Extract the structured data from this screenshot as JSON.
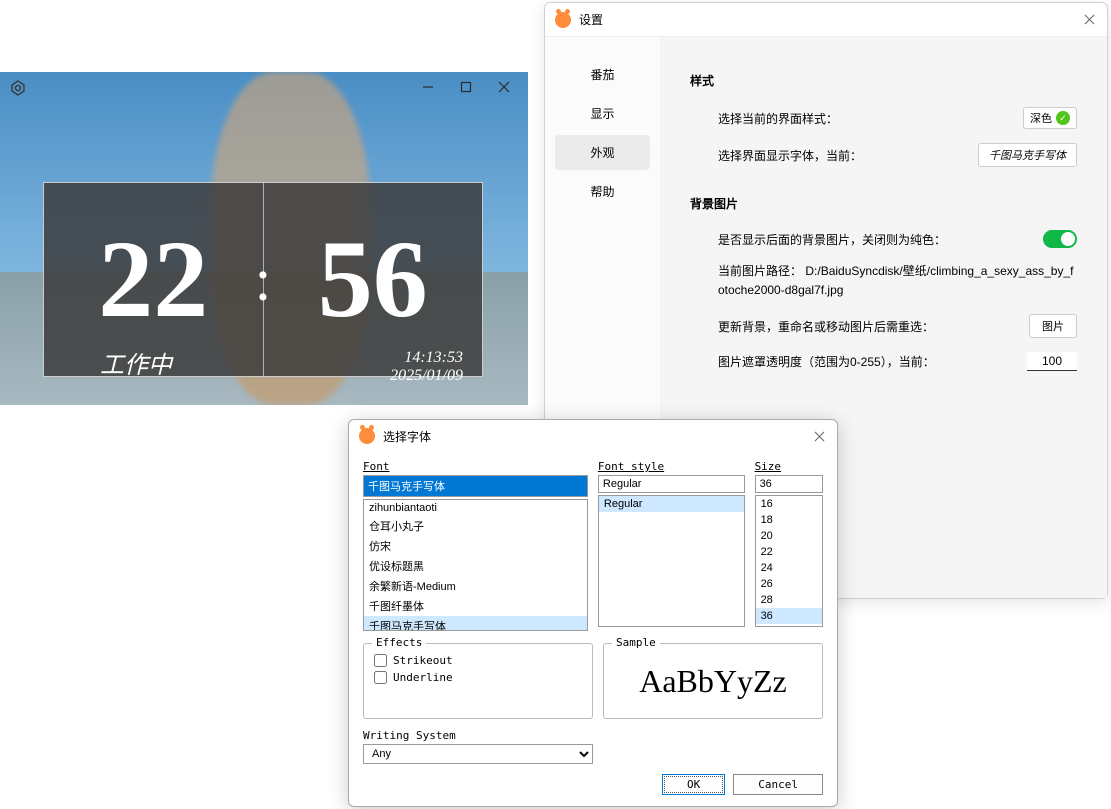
{
  "timer": {
    "hours": "22",
    "minutes": "56",
    "status": "工作中",
    "time": "14:13:53",
    "date": "2025/01/09"
  },
  "settings": {
    "title": "设置",
    "nav": [
      "番茄",
      "显示",
      "外观",
      "帮助"
    ],
    "style_section": "样式",
    "style_label": "选择当前的界面样式：",
    "style_value": "深色",
    "font_label": "选择界面显示字体，当前：",
    "font_value": "千图马克手写体",
    "bg_section": "背景图片",
    "bg_toggle_label": "是否显示后面的背景图片，关闭则为纯色：",
    "bg_path_label": "当前图片路径：",
    "bg_path": "D:/BaiduSyncdisk/壁纸/climbing_a_sexy_ass_by_fotoche2000-d8gal7f.jpg",
    "bg_update_label": "更新背景，重命名或移动图片后需重选：",
    "bg_update_btn": "图片",
    "bg_opacity_label": "图片遮罩透明度（范围为0-255），当前：",
    "bg_opacity_value": "100"
  },
  "font_dialog": {
    "title": "选择字体",
    "font_label": "Font",
    "font_input": "千图马克手写体",
    "font_list": [
      "zihunbiantaoti",
      "仓耳小丸子",
      "仿宋",
      "优设标题黑",
      "余繁新语-Medium",
      "千图纤墨体",
      "千图马克手写体"
    ],
    "style_label": "Font style",
    "style_input": "Regular",
    "style_list": [
      "Regular"
    ],
    "size_label": "Size",
    "size_input": "36",
    "size_list": [
      "16",
      "18",
      "20",
      "22",
      "24",
      "26",
      "28",
      "36"
    ],
    "effects_label": "Effects",
    "strikeout": "Strikeout",
    "underline": "Underline",
    "sample_label": "Sample",
    "sample_text": "AaBbYyZz",
    "ws_label": "Writing System",
    "ws_value": "Any",
    "ok": "OK",
    "cancel": "Cancel"
  }
}
